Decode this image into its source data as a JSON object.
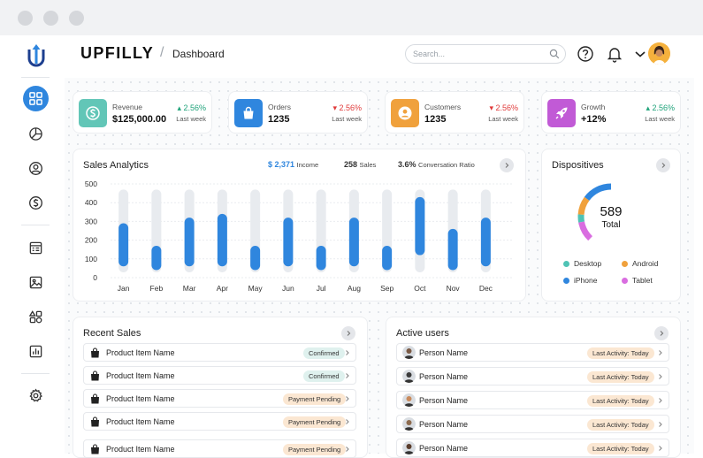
{
  "app": {
    "brand": "UPFILLY",
    "crumb_separator": "/",
    "page": "Dashboard"
  },
  "search": {
    "placeholder": "Search..."
  },
  "stats": [
    {
      "label": "Revenue",
      "value": "$125,000.00",
      "delta": "2.56%",
      "direction": "up",
      "period": "Last week",
      "color": "#62c6b7",
      "icon": "dollar-icon"
    },
    {
      "label": "Orders",
      "value": "1235",
      "delta": "2.56%",
      "direction": "down",
      "period": "Last week",
      "color": "#2f86de",
      "icon": "shopping-bag-icon"
    },
    {
      "label": "Customers",
      "value": "1235",
      "delta": "2.56%",
      "direction": "down",
      "period": "Last week",
      "color": "#f0a13c",
      "icon": "user-icon"
    },
    {
      "label": "Growth",
      "value": "+12%",
      "delta": "2.56%",
      "direction": "up",
      "period": "Last week",
      "color": "#c15ad6",
      "icon": "rocket-icon"
    }
  ],
  "sales": {
    "title": "Sales Analytics",
    "income_value": "$ 2,371",
    "income_label": "Income",
    "sales_value": "258",
    "sales_label": "Sales",
    "ratio_value": "3.6%",
    "ratio_label": "Conversation Ratio"
  },
  "chart_data": {
    "type": "bar",
    "title": "Sales Analytics",
    "categories": [
      "Jan",
      "Feb",
      "Mar",
      "Apr",
      "May",
      "Jun",
      "Jul",
      "Aug",
      "Sep",
      "Oct",
      "Nov",
      "Dec"
    ],
    "ranges": [
      [
        60,
        290
      ],
      [
        40,
        170
      ],
      [
        60,
        320
      ],
      [
        60,
        340
      ],
      [
        40,
        170
      ],
      [
        60,
        320
      ],
      [
        40,
        170
      ],
      [
        60,
        320
      ],
      [
        40,
        170
      ],
      [
        120,
        430
      ],
      [
        40,
        260
      ],
      [
        60,
        320
      ]
    ],
    "background_max": 470,
    "yticks": [
      "0",
      "100",
      "200",
      "300",
      "400",
      "500"
    ],
    "ylim": [
      0,
      500
    ],
    "bar_color": "#2f86de",
    "track_color": "#e8ebef"
  },
  "devices": {
    "title": "Dispositives",
    "total_value": "589",
    "total_label": "Total",
    "legend": [
      {
        "label": "Desktop",
        "color": "#4fc3b5"
      },
      {
        "label": "Android",
        "color": "#f0a13c"
      },
      {
        "label": "iPhone",
        "color": "#2f86de"
      },
      {
        "label": "Tablet",
        "color": "#d96de0"
      }
    ],
    "donut_fractions": [
      0.04,
      0.09,
      0.77,
      0.1
    ]
  },
  "recent_sales": {
    "title": "Recent Sales",
    "items": [
      {
        "name": "Product Item Name",
        "status": "Confirmed",
        "kind": "confirmed"
      },
      {
        "name": "Product Item Name",
        "status": "Confirmed",
        "kind": "confirmed"
      },
      {
        "name": "Product Item Name",
        "status": "Payment Pending",
        "kind": "pending"
      },
      {
        "name": "Product Item Name",
        "status": "Payment Pending",
        "kind": "pending"
      },
      {
        "name": "Product Item Name",
        "status": "Payment Pending",
        "kind": "pending"
      }
    ]
  },
  "active_users": {
    "title": "Active users",
    "items": [
      {
        "name": "Person Name",
        "activity": "Last Activity: Today"
      },
      {
        "name": "Person Name",
        "activity": "Last Activity: Today"
      },
      {
        "name": "Person Name",
        "activity": "Last Activity: Today"
      },
      {
        "name": "Person Name",
        "activity": "Last Activity: Today"
      },
      {
        "name": "Person Name",
        "activity": "Last Activity: Today"
      }
    ]
  },
  "colors": {
    "accent": "#2f86de"
  }
}
